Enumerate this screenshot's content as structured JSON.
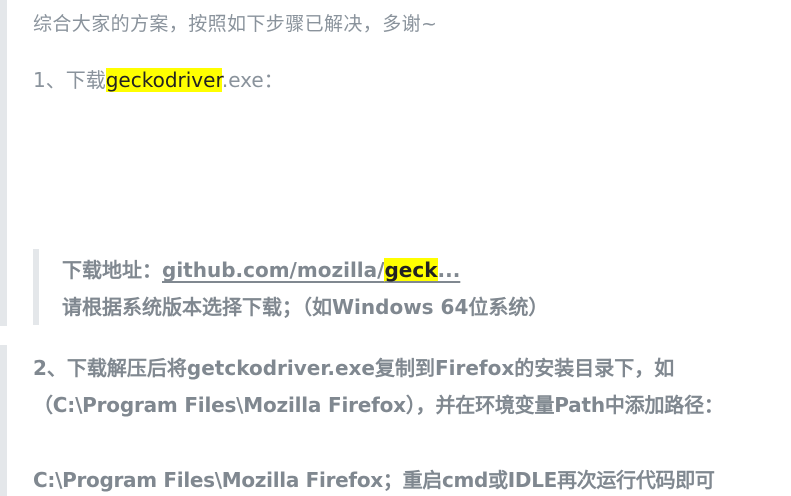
{
  "intro": "综合大家的方案，按照如下步骤已解决，多谢~",
  "step1": {
    "prefix": "1、下载",
    "highlight": "geckodriver",
    "suffix": ".exe："
  },
  "download": {
    "label": "下载地址：",
    "link_text": "github.com/mozilla/",
    "link_highlight": "geck",
    "link_ellipsis": "...",
    "note": "请根据系统版本选择下载；（如Windows 64位系统）"
  },
  "step2": {
    "line1": "2、下载解压后将getckodriver.exe复制到Firefox的安装目录下，如",
    "line2": "（C:\\Program Files\\Mozilla Firefox），并在环境变量Path中添加路径：",
    "line3": "C:\\Program Files\\Mozilla Firefox；重启cmd或IDLE再次运行代码即可"
  }
}
